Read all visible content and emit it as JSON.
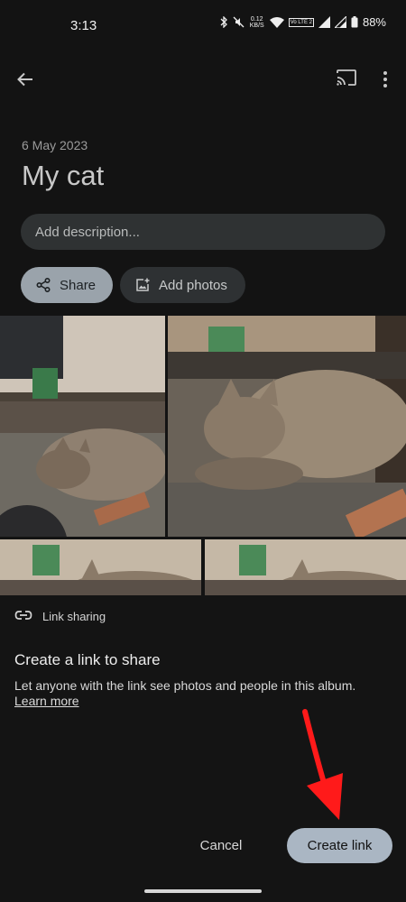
{
  "status_bar": {
    "time": "3:13",
    "net_speed_value": "0.12",
    "net_speed_unit": "KB/S",
    "lte_label": "Vo LTE 2",
    "battery": "88%"
  },
  "toolbar": {
    "back_icon": "arrow-back-icon",
    "cast_icon": "cast-icon",
    "more_icon": "more-vert-icon"
  },
  "album": {
    "date": "6 May 2023",
    "title": "My cat",
    "description_placeholder": "Add description..."
  },
  "actions": {
    "share_label": "Share",
    "add_photos_label": "Add photos"
  },
  "sheet": {
    "header": "Link sharing",
    "title": "Create a link to share",
    "body": "Let anyone with the link see photos and people in this album.",
    "learn_more": "Learn more",
    "cancel_label": "Cancel",
    "create_label": "Create link"
  },
  "colors": {
    "background": "#131313",
    "share_chip": "#9aa3ab",
    "create_button": "#aab6c3",
    "annotation_arrow": "#ff1a1a"
  }
}
